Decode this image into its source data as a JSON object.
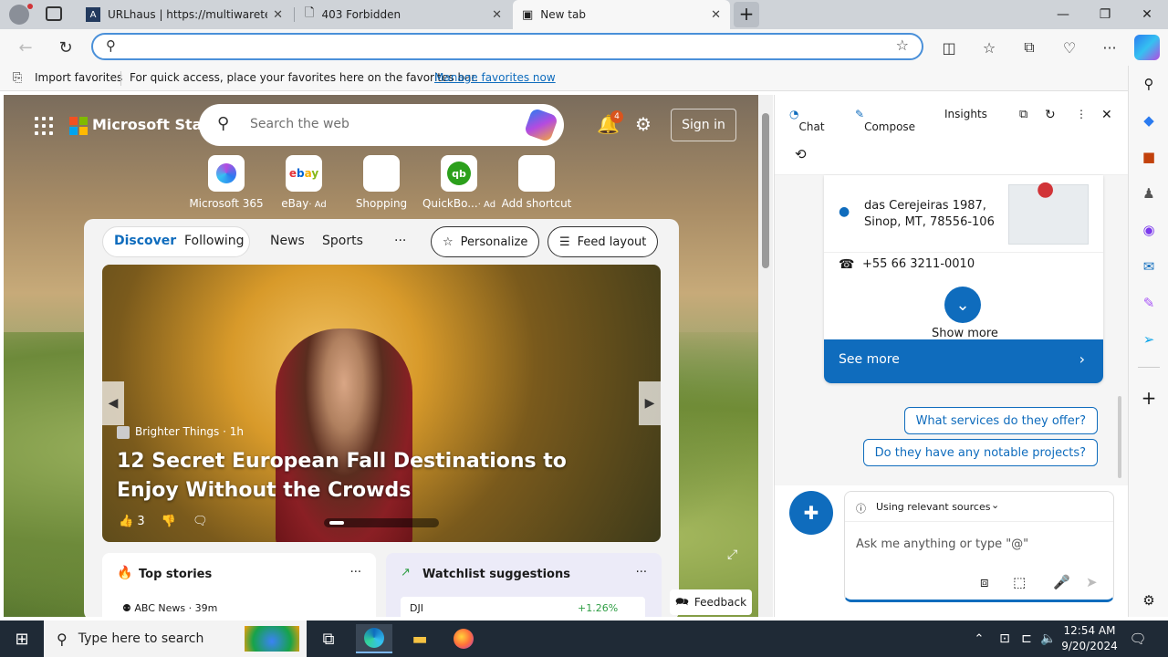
{
  "tabs": [
    {
      "title": "URLhaus | https://multiwaretecn..."
    },
    {
      "title": "403 Forbidden"
    },
    {
      "title": "New tab"
    }
  ],
  "address": {
    "value": "",
    "placeholder": ""
  },
  "favbar": {
    "import": "Import favorites",
    "hint": "For quick access, place your favorites here on the favorites bar.",
    "manage": "Manage favorites now"
  },
  "ntp": {
    "brand": "Microsoft Start",
    "search_placeholder": "Search the web",
    "notif_count": "4",
    "sign_in": "Sign in",
    "shortcuts": [
      {
        "label": "Microsoft 365",
        "ad": ""
      },
      {
        "label": "eBay",
        "ad": "· Ad"
      },
      {
        "label": "Shopping",
        "ad": ""
      },
      {
        "label": "QuickBo...",
        "ad": "· Ad"
      },
      {
        "label": "Add shortcut",
        "ad": ""
      }
    ],
    "nav": {
      "discover": "Discover",
      "following": "Following",
      "news": "News",
      "sports": "Sports",
      "more": "···",
      "personalize": "Personalize",
      "feed_layout": "Feed layout"
    },
    "hero": {
      "source": "Brighter Things · 1h",
      "headline": "12 Secret European Fall Destinations to Enjoy Without the Crowds",
      "likes": "3"
    },
    "top_stories": {
      "title": "Top stories",
      "first_source": "ABC News · 39m"
    },
    "watchlist": {
      "title": "Watchlist suggestions",
      "symbol": "DJI",
      "change": "+1.26%"
    },
    "feedback": "Feedback"
  },
  "sidepanel": {
    "tabs": {
      "chat": "Chat",
      "compose": "Compose",
      "insights": "Insights"
    },
    "address_line1": "das Cerejeiras 1987,",
    "address_line2": "Sinop, MT, 78556-106",
    "phone": "+55 66 3211-0010",
    "show_more": "Show more",
    "see_more": "See more",
    "suggestions": [
      "What services do they offer?",
      "Do they have any notable projects?"
    ],
    "sources": "Using relevant sources",
    "input_placeholder": "Ask me anything or type \"@\""
  },
  "taskbar": {
    "search_placeholder": "Type here to search",
    "time": "12:54 AM",
    "date": "9/20/2024"
  },
  "colors": {
    "accent": "#0f6cbd",
    "omnibox_focus": "#4a90d9",
    "taskbar": "#1f2a36"
  }
}
